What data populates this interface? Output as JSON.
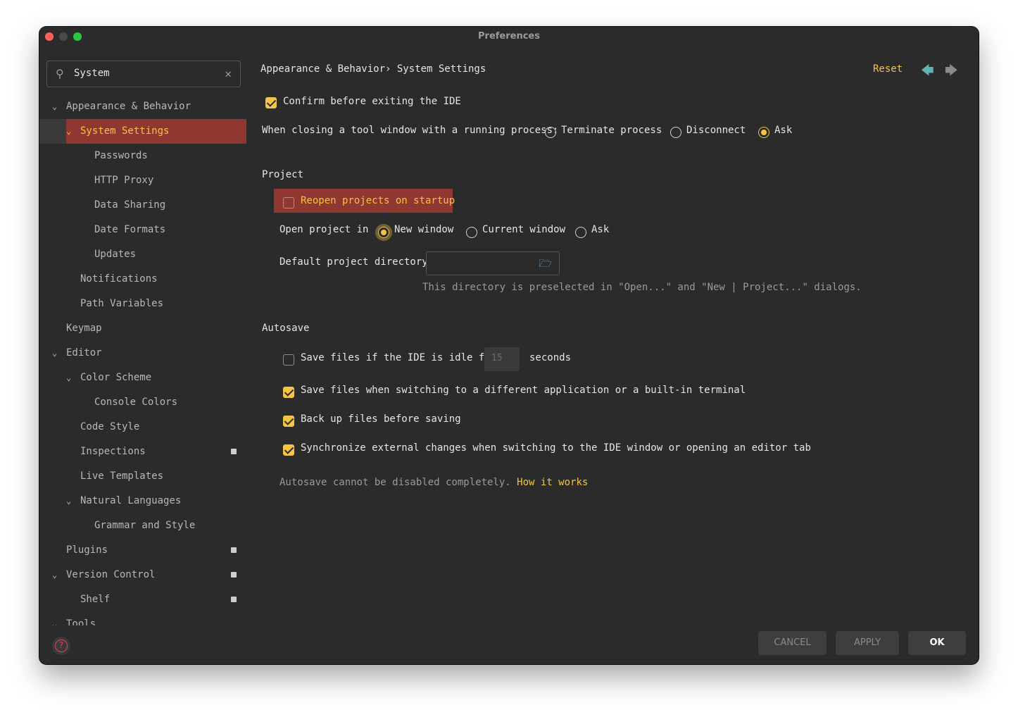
{
  "window": {
    "title": "Preferences"
  },
  "search": {
    "value": "System"
  },
  "tree": [
    {
      "label": "Appearance & Behavior",
      "chevron": "⌄"
    },
    {
      "label": "System Settings",
      "chevron": "⌄"
    },
    {
      "label": "Passwords"
    },
    {
      "label": "HTTP Proxy"
    },
    {
      "label": "Data Sharing"
    },
    {
      "label": "Date Formats"
    },
    {
      "label": "Updates"
    },
    {
      "label": "Notifications"
    },
    {
      "label": "Path Variables"
    },
    {
      "label": "Keymap"
    },
    {
      "label": "Editor",
      "chevron": "⌄"
    },
    {
      "label": "Color Scheme",
      "chevron": "⌄"
    },
    {
      "label": "Console Colors"
    },
    {
      "label": "Code Style"
    },
    {
      "label": "Inspections"
    },
    {
      "label": "Live Templates"
    },
    {
      "label": "Natural Languages",
      "chevron": "⌄"
    },
    {
      "label": "Grammar and Style"
    },
    {
      "label": "Plugins"
    },
    {
      "label": "Version Control",
      "chevron": "⌄"
    },
    {
      "label": "Shelf"
    },
    {
      "label": "Tools",
      "chevron": "⌄"
    }
  ],
  "header": {
    "breadcrumb": "Appearance & Behavior› System Settings",
    "reset": "Reset",
    "back_icon": "🡄",
    "forward_icon": "🡆"
  },
  "general": {
    "confirm_exit": "Confirm before exiting the IDE",
    "closing_label": "When closing a tool window with a running process:",
    "closing_options": [
      "Terminate process",
      "Disconnect",
      "Ask"
    ],
    "closing_selected": "Ask"
  },
  "project": {
    "title": "Project",
    "reopen": "Reopen projects on startup",
    "open_in_label": "Open project in",
    "open_in_options": [
      "New window",
      "Current window",
      "Ask"
    ],
    "open_in_selected": "New window",
    "default_dir_label": "Default project directory:",
    "default_dir_value": "",
    "hint": "This directory is preselected in \"Open...\" and \"New | Project...\" dialogs."
  },
  "autosave": {
    "title": "Autosave",
    "idle_label": "Save files if the IDE is idle for",
    "idle_value": "15",
    "idle_unit": "seconds",
    "switch_app": "Save files when switching to a different application or a built-in terminal",
    "backup": "Back up files before saving",
    "sync": "Synchronize external changes when switching to the IDE window or opening an editor tab",
    "note": "Autosave cannot be disabled completely.",
    "link": "How it works"
  },
  "buttons": {
    "cancel": "CANCEL",
    "apply": "APPLY",
    "ok": "OK"
  },
  "colors": {
    "accent": "#f5c542",
    "selection": "#8f3730",
    "background": "#2b2b2b"
  }
}
